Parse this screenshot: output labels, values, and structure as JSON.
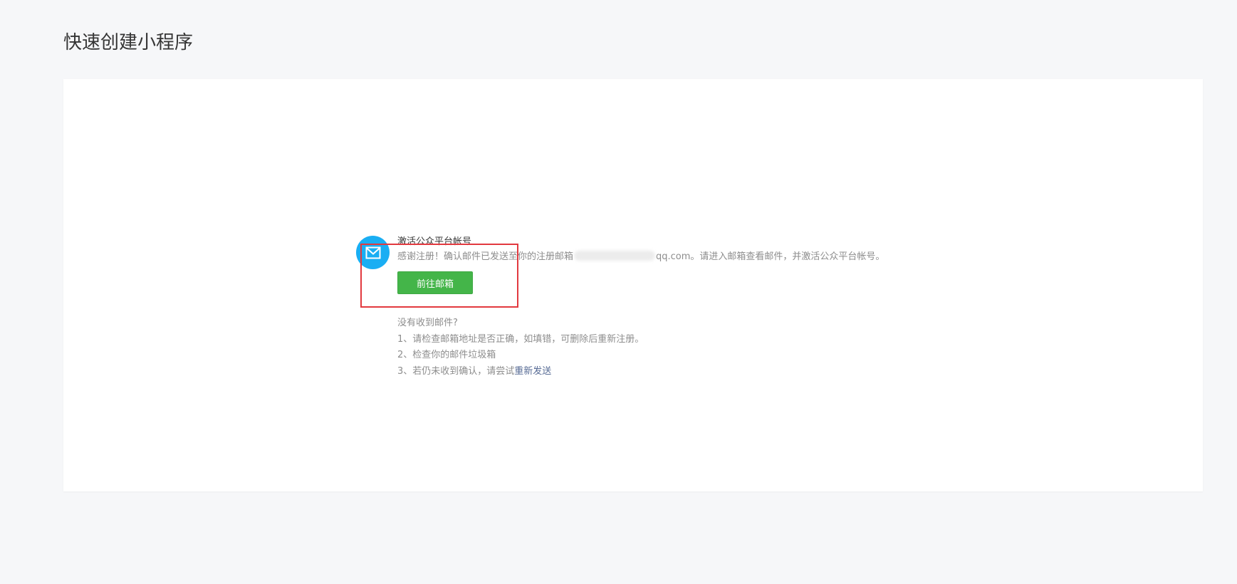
{
  "page": {
    "title": "快速创建小程序"
  },
  "activation": {
    "icon": "mail-icon",
    "title": "激活公众平台帐号",
    "desc_prefix": "感谢注册！确认邮件已发送至你的注册邮箱",
    "desc_suffix": "qq.com。请进入邮箱查看邮件，并激活公众平台帐号。",
    "goto_button_label": "前往邮箱"
  },
  "help": {
    "heading": "没有收到邮件?",
    "step1": "1、请检查邮箱地址是否正确，如填错，可删除后重新注册。",
    "step2": "2、检查你的邮件垃圾箱",
    "step3_prefix": "3、若仍未收到确认，请尝试",
    "resend_label": "重新发送"
  },
  "colors": {
    "page_bg": "#f6f7f9",
    "card_bg": "#ffffff",
    "icon_bg": "#1aaef3",
    "button_bg": "#44b549",
    "link": "#576b95",
    "highlight_box": "#e2393f"
  }
}
